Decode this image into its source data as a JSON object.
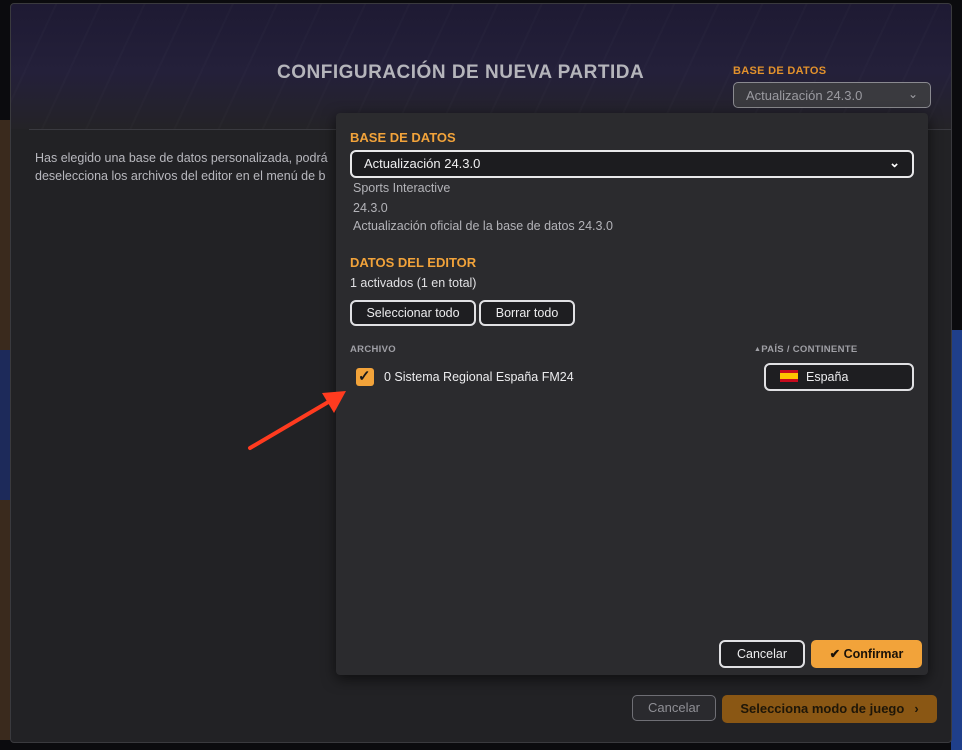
{
  "page": {
    "title": "CONFIGURACIÓN DE NUEVA PARTIDA",
    "database_label": "BASE DE DATOS",
    "database_value": "Actualización 24.3.0",
    "intro_text": [
      "Has elegido una base de datos personalizada, podrá",
      "deselecciona los archivos del editor en el menú de b"
    ],
    "cancel_label": "Cancelar",
    "next_label": "Selecciona modo de juego",
    "next_icon": "chevron-right-icon"
  },
  "modal": {
    "database_title": "BASE DE DATOS",
    "database_selected": "Actualización 24.3.0",
    "database_info": {
      "author": "Sports Interactive",
      "version": "24.3.0",
      "description": "Actualización oficial de la base de datos 24.3.0"
    },
    "editor_title": "DATOS DEL EDITOR",
    "activated_count": "1 activados (1 en total)",
    "select_all_label": "Seleccionar todo",
    "clear_all_label": "Borrar todo",
    "columns": {
      "file": "ARCHIVO",
      "country": "PAÍS / CONTINENTE",
      "country_sort_icon": "sort-asc-icon"
    },
    "files": [
      {
        "checked": true,
        "name": "0 Sistema Regional España FM24",
        "country": "España",
        "flag_icon": "spain-flag-icon"
      }
    ],
    "cancel_label": "Cancelar",
    "confirm_label": "Confirmar",
    "confirm_icon": "check-icon"
  },
  "colors": {
    "accent": "#f2a33a",
    "annotation_arrow": "#ff3b1f",
    "window_bg": "#222225",
    "modal_bg": "#2b2b2e"
  }
}
